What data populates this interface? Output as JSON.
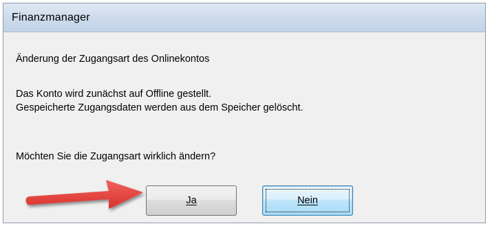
{
  "dialog": {
    "title": "Finanzmanager",
    "heading": "Änderung der Zugangsart des Onlinekontos",
    "body_line1": "Das Konto wird zunächst auf Offline gestellt.",
    "body_line2": "Gespeicherte Zugangsdaten werden aus dem Speicher gelöscht.",
    "question": "Möchten Sie die Zugangsart wirklich ändern?"
  },
  "buttons": {
    "yes_label": "Ja",
    "no_label": "Nein"
  },
  "annotation": {
    "arrow_color": "#e8413b",
    "arrow_icon": "red-arrow-icon"
  },
  "colors": {
    "titlebar": "#cfdcec",
    "dialog_bg": "#f0f0f0",
    "focused_button": "#bee6fd"
  }
}
